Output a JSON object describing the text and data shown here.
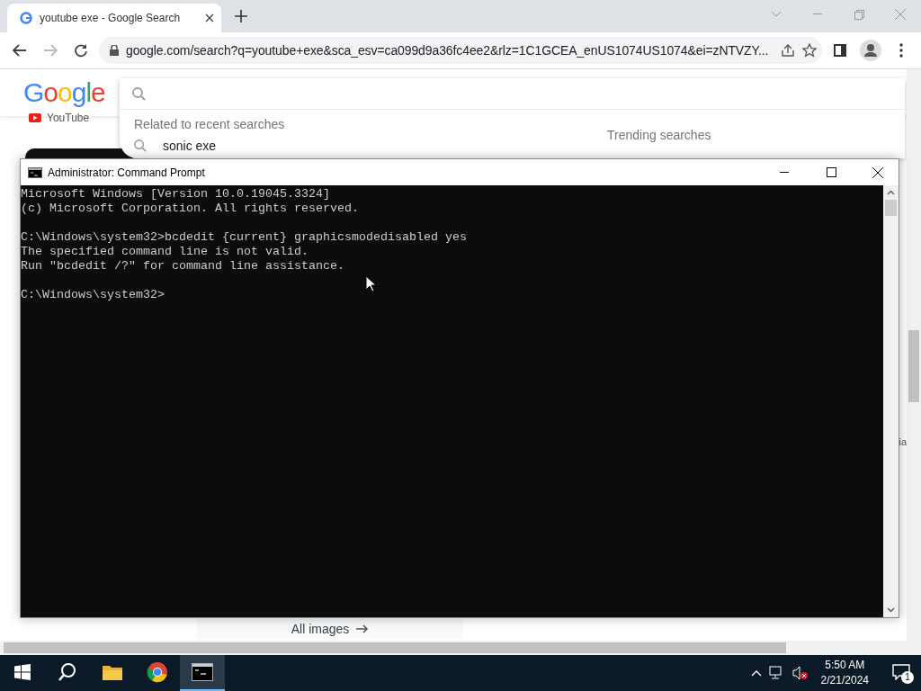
{
  "browser": {
    "tab": {
      "title": "youtube exe - Google Search"
    },
    "address": "google.com/search?q=youtube+exe&sca_esv=ca099d9a36fc4ee2&rlz=1C1GCEA_enUS1074US1074&ei=zNTVZY..."
  },
  "page": {
    "logo": "Google",
    "nav_item": "YouTube",
    "related_title": "Related to recent searches",
    "suggestions": [
      "sonic exe"
    ],
    "trending_title": "Trending searches",
    "all_images": "All images",
    "side_text": "ia"
  },
  "console": {
    "title": "Administrator: Command Prompt",
    "blocks": [
      [
        "Microsoft Windows [Version 10.0.19045.3324]",
        "(c) Microsoft Corporation. All rights reserved."
      ],
      [
        "C:\\Windows\\system32>bcdedit {current} graphicsmodedisabled yes",
        "The specified command line is not valid.",
        "Run \"bcdedit /?\" for command line assistance."
      ],
      [
        "C:\\Windows\\system32>"
      ]
    ]
  },
  "taskbar": {
    "apps": [
      {
        "kind": "search",
        "selected": false
      },
      {
        "kind": "files",
        "selected": false
      },
      {
        "kind": "chrome",
        "selected": false
      },
      {
        "kind": "terminal",
        "selected": true
      }
    ],
    "time": "5:50 AM",
    "date": "2/21/2024",
    "notifications": "1"
  }
}
